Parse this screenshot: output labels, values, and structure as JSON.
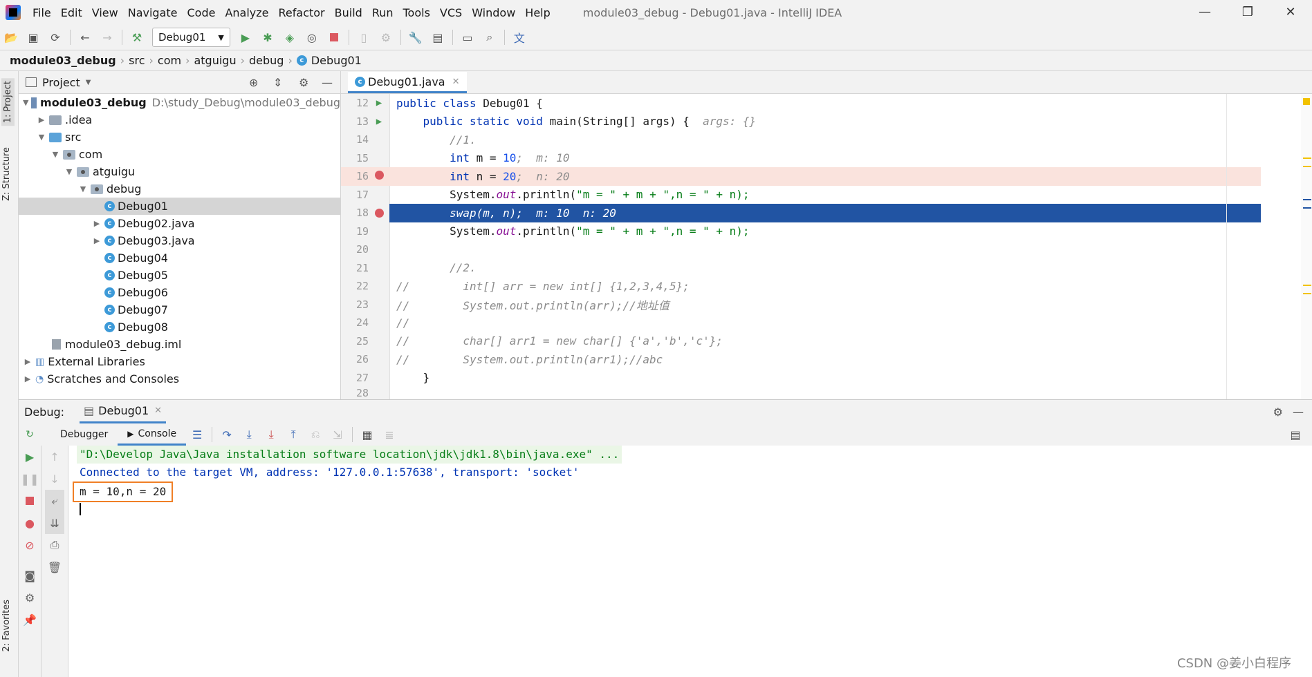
{
  "menu": {
    "items": [
      "File",
      "Edit",
      "View",
      "Navigate",
      "Code",
      "Analyze",
      "Refactor",
      "Build",
      "Run",
      "Tools",
      "VCS",
      "Window",
      "Help"
    ],
    "window_title": "module03_debug - Debug01.java - IntelliJ IDEA"
  },
  "toolbar": {
    "run_config": "Debug01"
  },
  "breadcrumb": [
    "module03_debug",
    "src",
    "com",
    "atguigu",
    "debug",
    "Debug01"
  ],
  "left_stripe": {
    "project_tab": "1: Project",
    "structure_tab": "Z: Structure",
    "favorites_tab": "2: Favorites"
  },
  "project_panel": {
    "title": "Project",
    "tree": [
      {
        "label": "module03_debug",
        "hint": "D:\\study_Debug\\module03_debug"
      },
      {
        "label": ".idea"
      },
      {
        "label": "src"
      },
      {
        "label": "com"
      },
      {
        "label": "atguigu"
      },
      {
        "label": "debug"
      },
      {
        "label": "Debug01"
      },
      {
        "label": "Debug02.java"
      },
      {
        "label": "Debug03.java"
      },
      {
        "label": "Debug04"
      },
      {
        "label": "Debug05"
      },
      {
        "label": "Debug06"
      },
      {
        "label": "Debug07"
      },
      {
        "label": "Debug08"
      },
      {
        "label": "module03_debug.iml"
      },
      {
        "label": "External Libraries"
      },
      {
        "label": "Scratches and Consoles"
      }
    ]
  },
  "editor": {
    "tab_label": "Debug01.java",
    "lines": [
      {
        "num": "12",
        "t1": "public class ",
        "t2": "Debug01 {",
        "t3": "",
        "t4": ""
      },
      {
        "num": "13",
        "t1": "    public static void ",
        "t2": "main(String[] args) {  ",
        "t3": "args: {}",
        "t4": ""
      },
      {
        "num": "14",
        "t1": "        //1.",
        "t2": "",
        "t3": "",
        "t4": ""
      },
      {
        "num": "15",
        "t1": "        int ",
        "t2": "m = ",
        "t3": "10",
        "t4": ";  m: 10"
      },
      {
        "num": "16",
        "t1": "        int ",
        "t2": "n = ",
        "t3": "20",
        "t4": ";  n: 20"
      },
      {
        "num": "17",
        "t1": "        System.",
        "t2": "out",
        "t3": ".println(",
        "t4": "\"m = \" + m + \",n = \" + n);"
      },
      {
        "num": "18",
        "t1": "        swap(m, n);  ",
        "t2": "m: 10  n: 20",
        "t3": "",
        "t4": ""
      },
      {
        "num": "19",
        "t1": "        System.",
        "t2": "out",
        "t3": ".println(",
        "t4": "\"m = \" + m + \",n = \" + n);"
      },
      {
        "num": "20",
        "t1": "",
        "t2": "",
        "t3": "",
        "t4": ""
      },
      {
        "num": "21",
        "t1": "        //2.",
        "t2": "",
        "t3": "",
        "t4": ""
      },
      {
        "num": "22",
        "t1": "//        int[] arr = new int[] {1,2,3,4,5};",
        "t2": "",
        "t3": "",
        "t4": ""
      },
      {
        "num": "23",
        "t1": "//        System.out.println(arr);//地址值",
        "t2": "",
        "t3": "",
        "t4": ""
      },
      {
        "num": "24",
        "t1": "//",
        "t2": "",
        "t3": "",
        "t4": ""
      },
      {
        "num": "25",
        "t1": "//        char[] arr1 = new char[] {'a','b','c'};",
        "t2": "",
        "t3": "",
        "t4": ""
      },
      {
        "num": "26",
        "t1": "//        System.out.println(arr1);//abc",
        "t2": "",
        "t3": "",
        "t4": ""
      },
      {
        "num": "27",
        "t1": "    }",
        "t2": "",
        "t3": "",
        "t4": ""
      },
      {
        "num": "28",
        "t1": "",
        "t2": "",
        "t3": "",
        "t4": ""
      }
    ]
  },
  "debug": {
    "label": "Debug:",
    "session_tab": "Debug01",
    "subtabs": [
      "Debugger",
      "Console"
    ],
    "console_lines": {
      "cmd": "\"D:\\Develop Java\\Java installation software location\\jdk\\jdk1.8\\bin\\java.exe\" ...",
      "connected": "Connected to the target VM, address: '127.0.0.1:57638', transport: 'socket'",
      "result": "m = 10,n = 20"
    }
  },
  "watermark": "CSDN @姜小白程序"
}
